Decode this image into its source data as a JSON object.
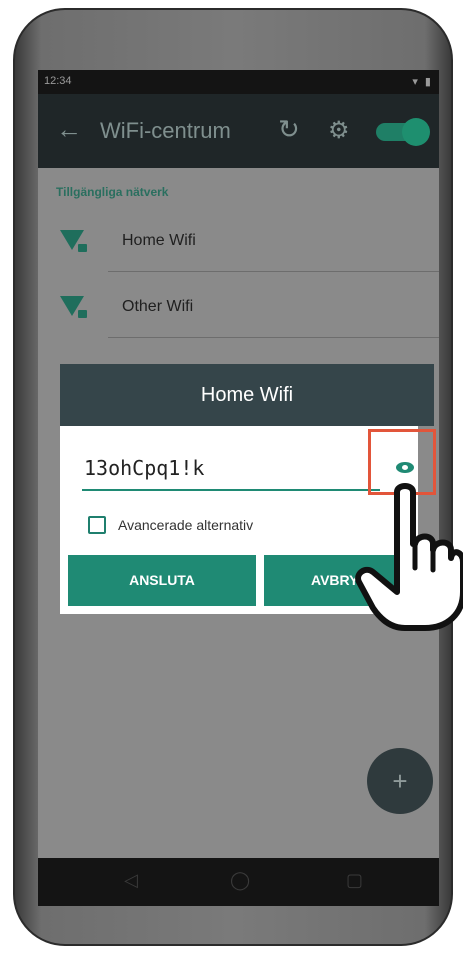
{
  "status_bar": {
    "time": "12:34",
    "icons": "▾ ▮"
  },
  "app_bar": {
    "title": "WiFi-centrum",
    "back_icon": "arrow-left-icon",
    "refresh_icon": "refresh-icon",
    "settings_icon": "gear-icon",
    "toggle_state": "on"
  },
  "networks": {
    "section_label": "Tillgängliga nätverk",
    "items": [
      {
        "name": "Home Wifi"
      },
      {
        "name": "Other Wifi"
      }
    ]
  },
  "dialog": {
    "title": "Home Wifi",
    "password_value": "13ohCpq1!k",
    "show_password_icon": "eye-icon",
    "advanced_label": "Avancerade alternativ",
    "connect_label": "ANSLUTA",
    "cancel_label": "AVBRYT"
  },
  "fab": {
    "label": "+"
  },
  "navbar": {
    "back": "◁",
    "home": "◯",
    "recents": "▢"
  },
  "colors": {
    "accent": "#1f8a74",
    "highlight": "#e2553a",
    "dialog_header": "#35454a"
  }
}
